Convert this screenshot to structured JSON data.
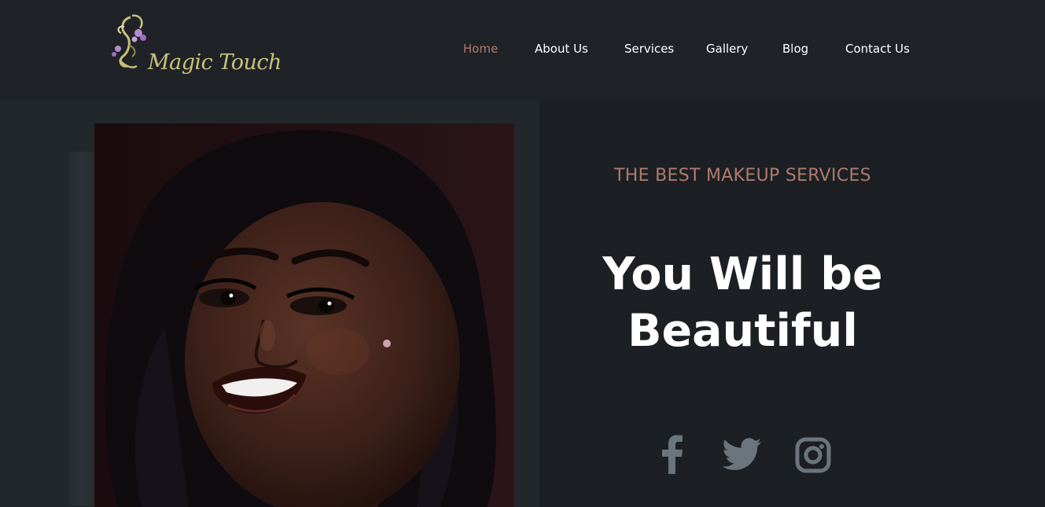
{
  "brand": {
    "name": "Magic Touch"
  },
  "nav": {
    "items": [
      {
        "label": "Home",
        "active": true
      },
      {
        "label": "About Us",
        "active": false
      },
      {
        "label": "Services",
        "active": false
      },
      {
        "label": "Gallery",
        "active": false
      },
      {
        "label": "Blog",
        "active": false
      },
      {
        "label": "Contact Us",
        "active": false
      }
    ]
  },
  "hero": {
    "eyebrow": "THE BEST MAKEUP SERVICES",
    "headline_line1": "You Will be",
    "headline_line2": "Beautiful"
  },
  "social": [
    {
      "icon": "facebook-icon"
    },
    {
      "icon": "twitter-icon"
    },
    {
      "icon": "instagram-icon"
    }
  ],
  "colors": {
    "accent": "#b07a6b",
    "header_bg": "#1f2328",
    "icon_gray": "#6c757d"
  }
}
